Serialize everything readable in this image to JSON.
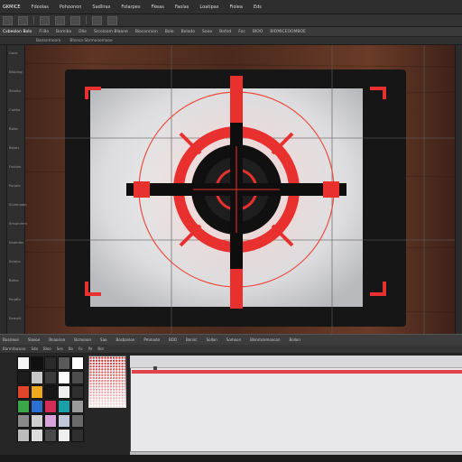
{
  "menubar": {
    "items": [
      "GKMICE",
      "Fdoolas",
      "Pohoonon",
      "Sadliras",
      "Folarpes",
      "Fkeas",
      "Faolas",
      "Loatipas",
      "Fiolea",
      "Eds"
    ]
  },
  "tabbar": {
    "tabs": [
      "Cxbeolon Bolo",
      "Fi Bo",
      "Bomibo",
      "Dlie",
      "Srcoloom Blaone",
      "Bioconnion",
      "Bolo",
      "Bolodo",
      "Sooo",
      "Bofod",
      "Foc",
      "BIOO",
      "BIOMICEOOMBOE"
    ]
  },
  "optionsbar": {
    "items": [
      "Bananmoore",
      "Bhiesa-Sbrmooomooe"
    ]
  },
  "ruler": {
    "labels": [
      "Goos",
      "Btibiing",
      "Sfcolbr",
      "Cudbo",
      "Boloc",
      "Bolols",
      "Fsiolon",
      "Ponolo",
      "Sicamoalp",
      "Smsinimm",
      "Eoomlos",
      "Soloco",
      "Bofos",
      "Pondlo",
      "Semoli"
    ]
  },
  "statusbar": {
    "items": [
      "Bossleoe",
      "Sloooe",
      "Bnaorion",
      "Bcmonon",
      "Sao",
      "Bosbanlon",
      "Pmmodo",
      "BOO",
      "Bonirc",
      "Sollon",
      "Somoon",
      "Blonmcemoocon",
      "Bollon"
    ]
  },
  "bottomtabs": {
    "items": [
      "Barmitacono",
      "Sda",
      "Bloo",
      "Ses",
      "Bo",
      "Fo",
      "Po",
      "Bor"
    ]
  },
  "colors": {
    "accent": "#e8312f",
    "wood": "#5a3222",
    "panel": "#2b2b2b",
    "paper": "#e9e9ea"
  },
  "swatches": [
    "#f4f4f4",
    "#101010",
    "#2a2a2a",
    "#5a5a5a",
    "#ffffff",
    "#1c1c1c",
    "#c7c7c7",
    "#3b3b3b",
    "#ffffff",
    "#4d4d4d",
    "#e0462a",
    "#f0a91e",
    "#171717",
    "#efefef",
    "#2f2f2f",
    "#3ba54a",
    "#2b6fd1",
    "#d12d56",
    "#1aa0a8",
    "#9a9a9a",
    "#8a8a8a",
    "#cfcfcf",
    "#d9a3d9",
    "#bfc7d9",
    "#6a6a6a",
    "#bcbcbc",
    "#dcdcdc",
    "#4a4a4a",
    "#efefef",
    "#2f2f2f"
  ],
  "icons": {
    "crosshair": "crosshair-target-icon",
    "corner": "selection-corner-icon"
  }
}
